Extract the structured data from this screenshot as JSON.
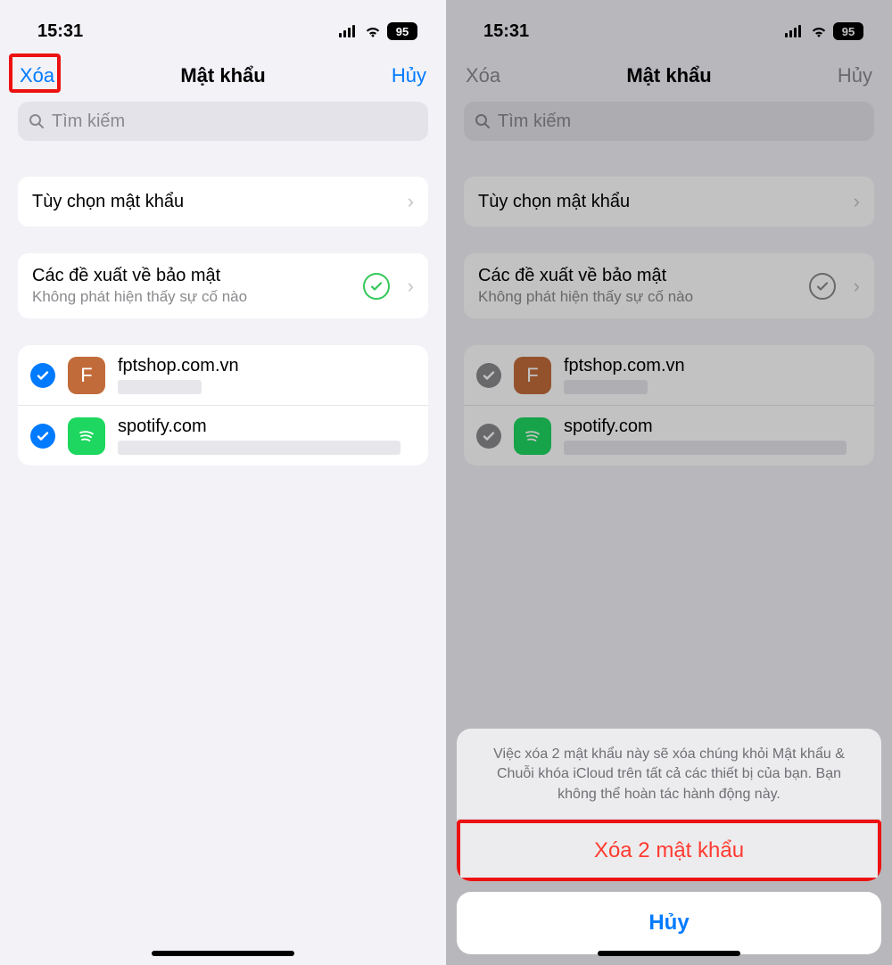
{
  "status": {
    "time": "15:31",
    "battery": "95"
  },
  "nav": {
    "delete": "Xóa",
    "title": "Mật khẩu",
    "cancel": "Hủy"
  },
  "search": {
    "placeholder": "Tìm kiếm"
  },
  "options_row": {
    "label": "Tùy chọn mật khẩu"
  },
  "security_row": {
    "title": "Các đề xuất về bảo mật",
    "subtitle": "Không phát hiện thấy sự cố nào"
  },
  "passwords": [
    {
      "site": "fptshop.com.vn",
      "icon_letter": "F",
      "icon_color": "orange"
    },
    {
      "site": "spotify.com",
      "icon_letter": "",
      "icon_color": "green"
    }
  ],
  "sheet": {
    "message": "Việc xóa 2 mật khẩu này sẽ xóa chúng khỏi Mật khẩu & Chuỗi khóa iCloud trên tất cả các thiết bị của bạn. Bạn không thể hoàn tác hành động này.",
    "delete_label": "Xóa 2 mật khẩu",
    "cancel_label": "Hủy"
  }
}
